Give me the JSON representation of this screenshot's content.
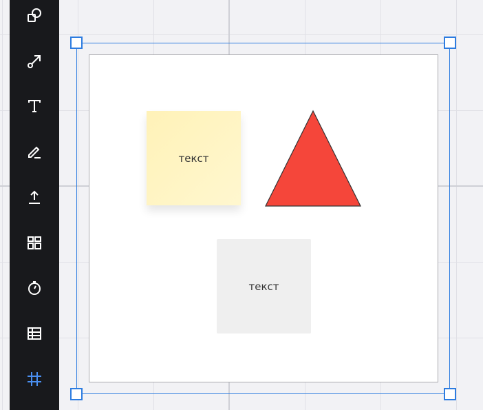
{
  "toolbar": {
    "tools": [
      {
        "name": "shapes",
        "icon": "shapes-icon"
      },
      {
        "name": "connector",
        "icon": "connector-icon"
      },
      {
        "name": "text",
        "icon": "text-icon"
      },
      {
        "name": "pen",
        "icon": "pen-icon"
      },
      {
        "name": "upload",
        "icon": "upload-icon"
      },
      {
        "name": "templates",
        "icon": "templates-icon"
      },
      {
        "name": "timer",
        "icon": "timer-icon"
      },
      {
        "name": "table",
        "icon": "table-icon"
      },
      {
        "name": "frame",
        "icon": "frame-icon",
        "active": true
      }
    ]
  },
  "colors": {
    "toolbar_bg": "#18191c",
    "icon": "#ffffff",
    "icon_active": "#4a8ff0",
    "selection": "#2d7ce0",
    "sticky": "#fff4c0",
    "triangle_fill": "#f5463a",
    "triangle_stroke": "#333333",
    "card": "#efefef"
  },
  "canvas": {
    "sticky_note": {
      "text": "текст"
    },
    "gray_card": {
      "text": "текст"
    },
    "triangle": {
      "fill": "#f5463a"
    }
  }
}
